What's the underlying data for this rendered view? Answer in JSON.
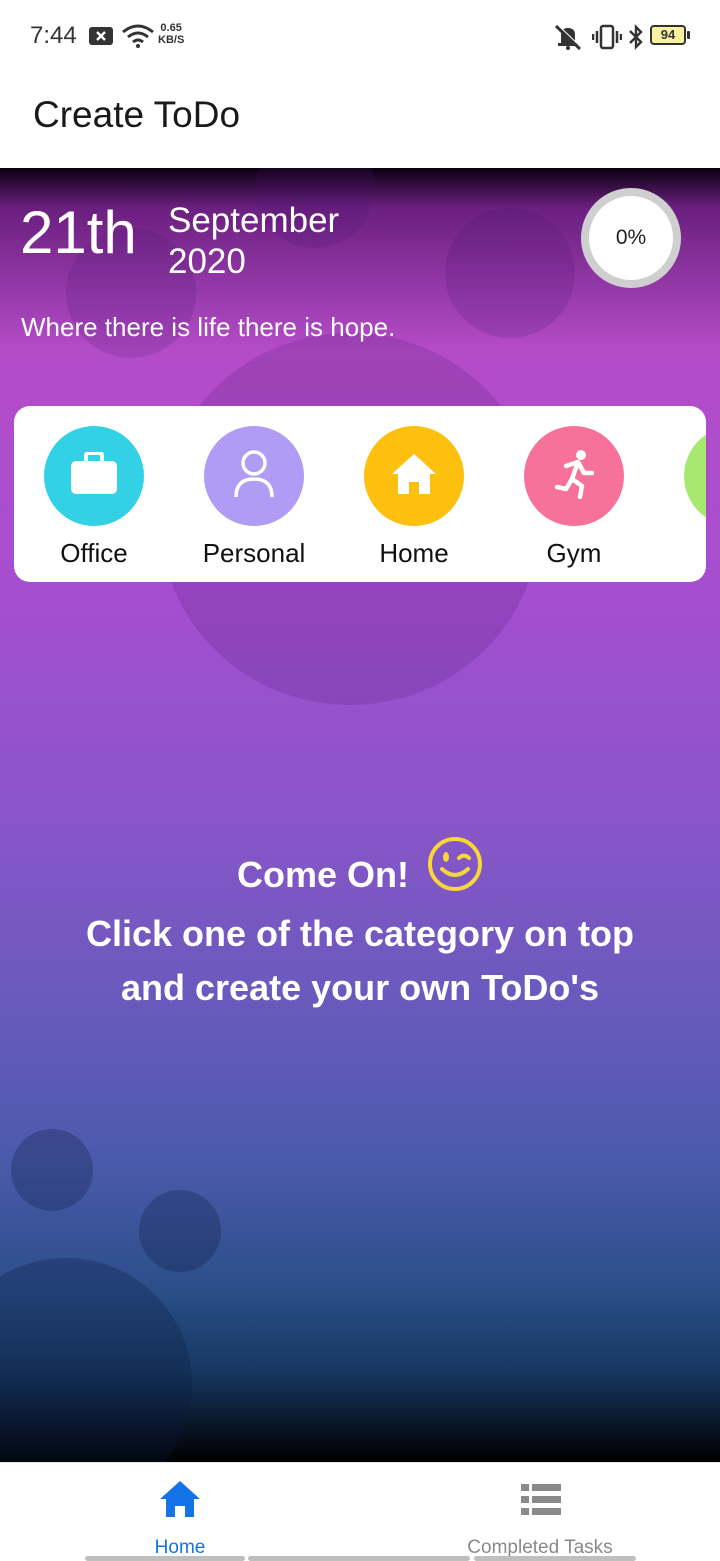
{
  "status_bar": {
    "time": "7:44",
    "net_speed_value": "0.65",
    "net_speed_unit": "KB/S",
    "battery": "94",
    "icons": [
      "notification-icon",
      "wifi-icon",
      "mute-icon",
      "vibrate-icon",
      "bluetooth-icon",
      "battery-icon"
    ]
  },
  "app_bar": {
    "title": "Create ToDo"
  },
  "header": {
    "day": "21th",
    "month": "September",
    "year": "2020",
    "progress": "0%",
    "quote": "Where there is life there is hope."
  },
  "categories": [
    {
      "label": "Office",
      "icon": "briefcase-icon",
      "color": "#33d1e6"
    },
    {
      "label": "Personal",
      "icon": "person-icon",
      "color": "#b09cf4"
    },
    {
      "label": "Home",
      "icon": "home-icon",
      "color": "#fdc00e"
    },
    {
      "label": "Gym",
      "icon": "running-icon",
      "color": "#f7729a"
    },
    {
      "label": "",
      "icon": "",
      "color": "#a8e86f"
    }
  ],
  "empty_message": {
    "line1": "Come On!",
    "line2": "Click one of the category on top",
    "line3": "and create your own ToDo's"
  },
  "bottom_nav": {
    "home_label": "Home",
    "completed_label": "Completed Tasks",
    "active_color": "#1473e6",
    "inactive_color": "#8a8a8a"
  }
}
